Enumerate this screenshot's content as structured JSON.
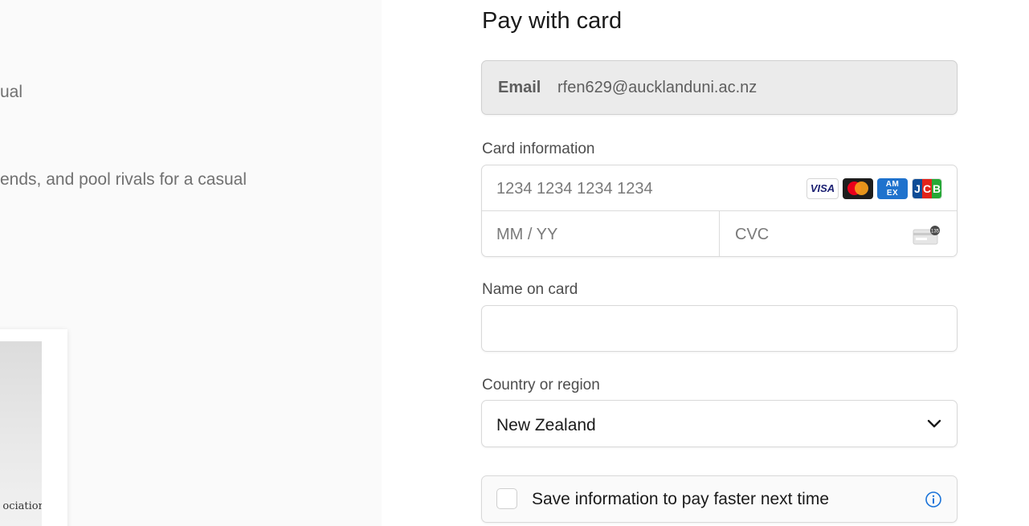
{
  "left_panel": {
    "fragment_1": "ual",
    "fragment_2": "ends, and pool rivals for a casual",
    "product_caption": "ociation"
  },
  "payment": {
    "title": "Pay with card",
    "email": {
      "label": "Email",
      "value": "rfen629@aucklanduni.ac.nz"
    },
    "card": {
      "label": "Card information",
      "number_placeholder": "1234 1234 1234 1234",
      "expiry_placeholder": "MM / YY",
      "cvc_placeholder": "CVC",
      "brands": [
        {
          "name": "VISA",
          "icon": "visa-icon"
        },
        {
          "name": "Mastercard",
          "icon": "mastercard-icon"
        },
        {
          "name": "AMEX",
          "icon": "amex-icon"
        },
        {
          "name": "JCB",
          "icon": "jcb-icon"
        }
      ],
      "cvc_icon_text": "135"
    },
    "name": {
      "label": "Name on card",
      "value": ""
    },
    "country": {
      "label": "Country or region",
      "value": "New Zealand"
    },
    "save": {
      "label": "Save information to pay faster next time",
      "checked": false
    }
  },
  "colors": {
    "info_blue": "#1a73d9",
    "email_bg": "#ebebeb",
    "border": "#d9d9d9"
  }
}
